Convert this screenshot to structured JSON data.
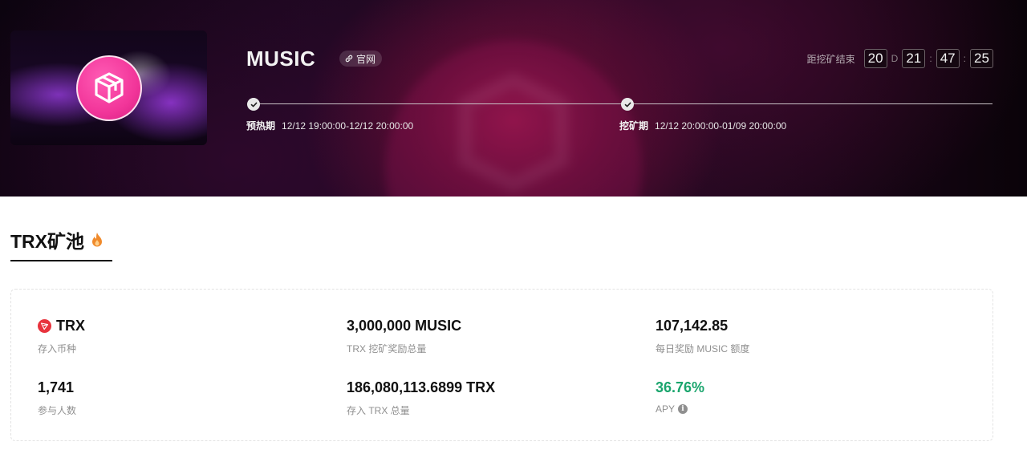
{
  "hero": {
    "title": "MUSIC",
    "site_link_label": "官网",
    "countdown": {
      "label": "距挖矿结束",
      "days": "20",
      "days_unit": "D",
      "hours": "21",
      "minutes": "47",
      "seconds": "25",
      "separator": ":"
    },
    "timeline": [
      {
        "phase": "预热期",
        "range": "12/12 19:00:00-12/12 20:00:00"
      },
      {
        "phase": "挖矿期",
        "range": "12/12 20:00:00-01/09 20:00:00"
      }
    ]
  },
  "pool": {
    "title": "TRX矿池",
    "stats": [
      {
        "value": "TRX",
        "label": "存入币种"
      },
      {
        "value": "3,000,000 MUSIC",
        "label": "TRX 挖矿奖励总量"
      },
      {
        "value": "107,142.85",
        "label": "每日奖励 MUSIC 额度"
      },
      {
        "value": "1,741",
        "label": "参与人数"
      },
      {
        "value": "186,080,113.6899 TRX",
        "label": "存入 TRX 总量"
      },
      {
        "value": "36.76%",
        "label": "APY"
      }
    ]
  },
  "colors": {
    "brand_pink": "#f2369a",
    "apy_green": "#1aa56d",
    "trx_red": "#e8333d",
    "fire_orange": "#f08a2b"
  },
  "icons": [
    "box-logo-icon",
    "link-icon",
    "check-icon",
    "fire-icon",
    "trx-icon",
    "info-icon"
  ]
}
